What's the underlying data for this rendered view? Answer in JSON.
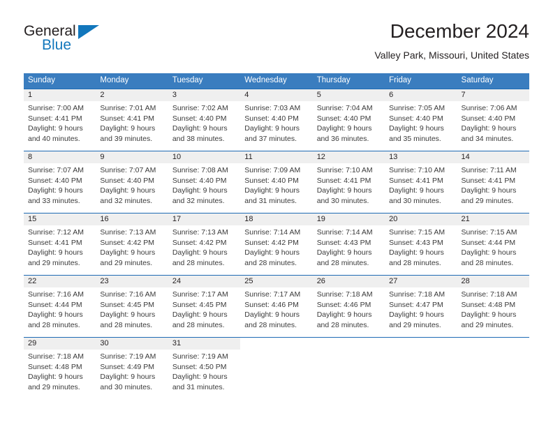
{
  "brand": {
    "name_part1": "General",
    "name_part2": "Blue",
    "triangle_icon": "blue-triangle-icon",
    "accent_color": "#1277bc"
  },
  "header": {
    "title": "December 2024",
    "subtitle": "Valley Park, Missouri, United States"
  },
  "theme": {
    "header_row_bg": "#3a7dbf",
    "row_divider": "#1d6ab4",
    "day_band_bg": "#efefef",
    "text": "#231f20"
  },
  "calendar": {
    "weekdays": [
      "Sunday",
      "Monday",
      "Tuesday",
      "Wednesday",
      "Thursday",
      "Friday",
      "Saturday"
    ],
    "weeks": [
      [
        {
          "day": "1",
          "sunrise": "Sunrise: 7:00 AM",
          "sunset": "Sunset: 4:41 PM",
          "daylight_line1": "Daylight: 9 hours",
          "daylight_line2": "and 40 minutes."
        },
        {
          "day": "2",
          "sunrise": "Sunrise: 7:01 AM",
          "sunset": "Sunset: 4:41 PM",
          "daylight_line1": "Daylight: 9 hours",
          "daylight_line2": "and 39 minutes."
        },
        {
          "day": "3",
          "sunrise": "Sunrise: 7:02 AM",
          "sunset": "Sunset: 4:40 PM",
          "daylight_line1": "Daylight: 9 hours",
          "daylight_line2": "and 38 minutes."
        },
        {
          "day": "4",
          "sunrise": "Sunrise: 7:03 AM",
          "sunset": "Sunset: 4:40 PM",
          "daylight_line1": "Daylight: 9 hours",
          "daylight_line2": "and 37 minutes."
        },
        {
          "day": "5",
          "sunrise": "Sunrise: 7:04 AM",
          "sunset": "Sunset: 4:40 PM",
          "daylight_line1": "Daylight: 9 hours",
          "daylight_line2": "and 36 minutes."
        },
        {
          "day": "6",
          "sunrise": "Sunrise: 7:05 AM",
          "sunset": "Sunset: 4:40 PM",
          "daylight_line1": "Daylight: 9 hours",
          "daylight_line2": "and 35 minutes."
        },
        {
          "day": "7",
          "sunrise": "Sunrise: 7:06 AM",
          "sunset": "Sunset: 4:40 PM",
          "daylight_line1": "Daylight: 9 hours",
          "daylight_line2": "and 34 minutes."
        }
      ],
      [
        {
          "day": "8",
          "sunrise": "Sunrise: 7:07 AM",
          "sunset": "Sunset: 4:40 PM",
          "daylight_line1": "Daylight: 9 hours",
          "daylight_line2": "and 33 minutes."
        },
        {
          "day": "9",
          "sunrise": "Sunrise: 7:07 AM",
          "sunset": "Sunset: 4:40 PM",
          "daylight_line1": "Daylight: 9 hours",
          "daylight_line2": "and 32 minutes."
        },
        {
          "day": "10",
          "sunrise": "Sunrise: 7:08 AM",
          "sunset": "Sunset: 4:40 PM",
          "daylight_line1": "Daylight: 9 hours",
          "daylight_line2": "and 32 minutes."
        },
        {
          "day": "11",
          "sunrise": "Sunrise: 7:09 AM",
          "sunset": "Sunset: 4:40 PM",
          "daylight_line1": "Daylight: 9 hours",
          "daylight_line2": "and 31 minutes."
        },
        {
          "day": "12",
          "sunrise": "Sunrise: 7:10 AM",
          "sunset": "Sunset: 4:41 PM",
          "daylight_line1": "Daylight: 9 hours",
          "daylight_line2": "and 30 minutes."
        },
        {
          "day": "13",
          "sunrise": "Sunrise: 7:10 AM",
          "sunset": "Sunset: 4:41 PM",
          "daylight_line1": "Daylight: 9 hours",
          "daylight_line2": "and 30 minutes."
        },
        {
          "day": "14",
          "sunrise": "Sunrise: 7:11 AM",
          "sunset": "Sunset: 4:41 PM",
          "daylight_line1": "Daylight: 9 hours",
          "daylight_line2": "and 29 minutes."
        }
      ],
      [
        {
          "day": "15",
          "sunrise": "Sunrise: 7:12 AM",
          "sunset": "Sunset: 4:41 PM",
          "daylight_line1": "Daylight: 9 hours",
          "daylight_line2": "and 29 minutes."
        },
        {
          "day": "16",
          "sunrise": "Sunrise: 7:13 AM",
          "sunset": "Sunset: 4:42 PM",
          "daylight_line1": "Daylight: 9 hours",
          "daylight_line2": "and 29 minutes."
        },
        {
          "day": "17",
          "sunrise": "Sunrise: 7:13 AM",
          "sunset": "Sunset: 4:42 PM",
          "daylight_line1": "Daylight: 9 hours",
          "daylight_line2": "and 28 minutes."
        },
        {
          "day": "18",
          "sunrise": "Sunrise: 7:14 AM",
          "sunset": "Sunset: 4:42 PM",
          "daylight_line1": "Daylight: 9 hours",
          "daylight_line2": "and 28 minutes."
        },
        {
          "day": "19",
          "sunrise": "Sunrise: 7:14 AM",
          "sunset": "Sunset: 4:43 PM",
          "daylight_line1": "Daylight: 9 hours",
          "daylight_line2": "and 28 minutes."
        },
        {
          "day": "20",
          "sunrise": "Sunrise: 7:15 AM",
          "sunset": "Sunset: 4:43 PM",
          "daylight_line1": "Daylight: 9 hours",
          "daylight_line2": "and 28 minutes."
        },
        {
          "day": "21",
          "sunrise": "Sunrise: 7:15 AM",
          "sunset": "Sunset: 4:44 PM",
          "daylight_line1": "Daylight: 9 hours",
          "daylight_line2": "and 28 minutes."
        }
      ],
      [
        {
          "day": "22",
          "sunrise": "Sunrise: 7:16 AM",
          "sunset": "Sunset: 4:44 PM",
          "daylight_line1": "Daylight: 9 hours",
          "daylight_line2": "and 28 minutes."
        },
        {
          "day": "23",
          "sunrise": "Sunrise: 7:16 AM",
          "sunset": "Sunset: 4:45 PM",
          "daylight_line1": "Daylight: 9 hours",
          "daylight_line2": "and 28 minutes."
        },
        {
          "day": "24",
          "sunrise": "Sunrise: 7:17 AM",
          "sunset": "Sunset: 4:45 PM",
          "daylight_line1": "Daylight: 9 hours",
          "daylight_line2": "and 28 minutes."
        },
        {
          "day": "25",
          "sunrise": "Sunrise: 7:17 AM",
          "sunset": "Sunset: 4:46 PM",
          "daylight_line1": "Daylight: 9 hours",
          "daylight_line2": "and 28 minutes."
        },
        {
          "day": "26",
          "sunrise": "Sunrise: 7:18 AM",
          "sunset": "Sunset: 4:46 PM",
          "daylight_line1": "Daylight: 9 hours",
          "daylight_line2": "and 28 minutes."
        },
        {
          "day": "27",
          "sunrise": "Sunrise: 7:18 AM",
          "sunset": "Sunset: 4:47 PM",
          "daylight_line1": "Daylight: 9 hours",
          "daylight_line2": "and 29 minutes."
        },
        {
          "day": "28",
          "sunrise": "Sunrise: 7:18 AM",
          "sunset": "Sunset: 4:48 PM",
          "daylight_line1": "Daylight: 9 hours",
          "daylight_line2": "and 29 minutes."
        }
      ],
      [
        {
          "day": "29",
          "sunrise": "Sunrise: 7:18 AM",
          "sunset": "Sunset: 4:48 PM",
          "daylight_line1": "Daylight: 9 hours",
          "daylight_line2": "and 29 minutes."
        },
        {
          "day": "30",
          "sunrise": "Sunrise: 7:19 AM",
          "sunset": "Sunset: 4:49 PM",
          "daylight_line1": "Daylight: 9 hours",
          "daylight_line2": "and 30 minutes."
        },
        {
          "day": "31",
          "sunrise": "Sunrise: 7:19 AM",
          "sunset": "Sunset: 4:50 PM",
          "daylight_line1": "Daylight: 9 hours",
          "daylight_line2": "and 31 minutes."
        },
        {
          "day": "",
          "sunrise": "",
          "sunset": "",
          "daylight_line1": "",
          "daylight_line2": ""
        },
        {
          "day": "",
          "sunrise": "",
          "sunset": "",
          "daylight_line1": "",
          "daylight_line2": ""
        },
        {
          "day": "",
          "sunrise": "",
          "sunset": "",
          "daylight_line1": "",
          "daylight_line2": ""
        },
        {
          "day": "",
          "sunrise": "",
          "sunset": "",
          "daylight_line1": "",
          "daylight_line2": ""
        }
      ]
    ]
  }
}
